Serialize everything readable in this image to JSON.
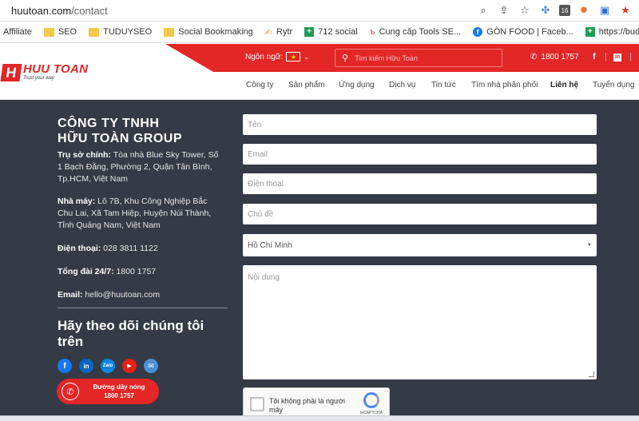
{
  "browser": {
    "url_host": "huutoan.com",
    "url_path": "/contact"
  },
  "bookmarks": [
    {
      "label": "Affiliate",
      "icon": "none"
    },
    {
      "label": "SEO",
      "icon": "folder-icon"
    },
    {
      "label": "TUDUYSEO",
      "icon": "folder-icon"
    },
    {
      "label": "Social Bookmaking",
      "icon": "folder-icon"
    },
    {
      "label": "Rytr",
      "icon": "rytr-icon"
    },
    {
      "label": "712 social",
      "icon": "green-plus-icon"
    },
    {
      "label": "Cung cấp Tools SE...",
      "icon": "site-icon"
    },
    {
      "label": "GÒN FOOD | Faceb...",
      "icon": "facebook-icon"
    },
    {
      "label": "https://buddhismar...",
      "icon": "green-plus-icon"
    }
  ],
  "header": {
    "logo_mark": "H",
    "logo_name": "HUU TOAN",
    "logo_tagline": "Trust your way",
    "lang_label": "Ngôn ngữ:",
    "flag_star": "★",
    "chevron": "⌄",
    "search_placeholder": "Tìm kiếm Hữu Toàn",
    "hotline": "1800 1757",
    "social_fb": "f",
    "social_sep": "|",
    "social_in": "in"
  },
  "nav": [
    {
      "label": "Công ty",
      "active": false
    },
    {
      "label": "Sản phẩm",
      "active": false
    },
    {
      "label": "Ứng dụng",
      "active": false
    },
    {
      "label": "Dịch vụ",
      "active": false
    },
    {
      "label": "Tin tức",
      "active": false
    },
    {
      "label": "Tìm nhà phân phối",
      "active": false
    },
    {
      "label": "Liên hệ",
      "active": true
    },
    {
      "label": "Tuyển dụng",
      "active": false
    }
  ],
  "company": {
    "name_line1": "CÔNG TY TNHH",
    "name_line2": "HỮU TOÀN GROUP",
    "hq_label": "Trụ sở chính:",
    "hq_value": " Tòa nhà Blue Sky Tower, Số 1 Bạch Đằng, Phường 2, Quận Tân Bình, Tp.HCM, Việt Nam",
    "factory_label": "Nhà máy:",
    "factory_value": " Lô 7B, Khu Công Nghiệp Bắc Chu Lai, Xã Tam Hiệp, Huyện Núi Thành, Tỉnh Quảng Nam, Việt Nam",
    "phone_label": "Điện thoại:",
    "phone_value": " 028 3811 1122",
    "switchboard_label": "Tổng đài 24/7:",
    "switchboard_value": " 1800 1757",
    "email_label": "Email:",
    "email_value": " hello@huutoan.com",
    "follow_title": "Hãy theo dõi chúng tôi trên",
    "socials": [
      "f",
      "in",
      "Zalo",
      "▶",
      "✉"
    ],
    "hotline_btn_line1": "Đường dây nóng",
    "hotline_btn_line2": "1800 1757"
  },
  "form": {
    "name_placeholder": "Tên",
    "email_placeholder": "Email",
    "phone_placeholder": "Điện thoại",
    "subject_placeholder": "Chủ đề",
    "city_selected": "Hồ Chí Minh",
    "content_placeholder": "Nội dung",
    "captcha_text": "Tôi không phải là người máy",
    "captcha_brand": "reCAPTCHA"
  }
}
